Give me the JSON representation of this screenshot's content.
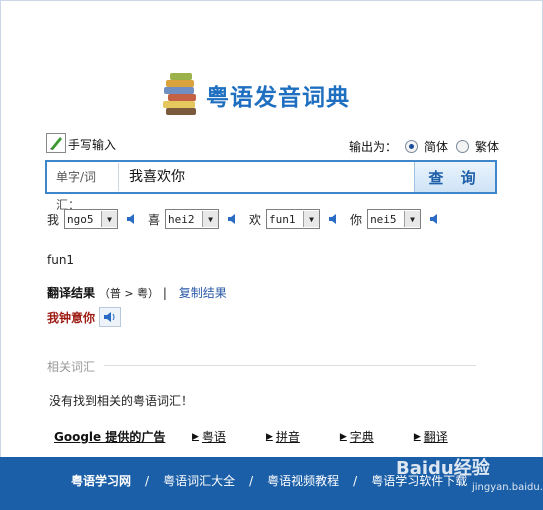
{
  "app": {
    "title": "粤语发音词典"
  },
  "handwrite": {
    "label": "手写输入"
  },
  "output": {
    "label": "输出为：",
    "options": [
      {
        "label": "简体",
        "selected": true
      },
      {
        "label": "繁体",
        "selected": false
      }
    ]
  },
  "search": {
    "field_label": "单字/词汇：",
    "value": "我喜欢你",
    "button": "查 询"
  },
  "syllables": [
    {
      "char": "我",
      "value": "ngo5"
    },
    {
      "char": "喜",
      "value": "hei2"
    },
    {
      "char": "欢",
      "value": "fun1"
    },
    {
      "char": "你",
      "value": "nei5"
    }
  ],
  "phonetic_line": "fun1",
  "translation": {
    "label": "翻译结果",
    "direction": "（普 > 粤）",
    "separator": "|",
    "copy_link": "复制结果",
    "result": "我钟意你"
  },
  "related": {
    "title": "相关词汇",
    "empty_message": "没有找到相关的粤语词汇！"
  },
  "ads": {
    "google_label": "Google 提供的广告",
    "links": [
      "粤语",
      "拼音",
      "字典",
      "翻译"
    ]
  },
  "footer": {
    "links": [
      "粤语学习网",
      "粤语词汇大全",
      "粤语视频教程",
      "粤语学习软件下载"
    ],
    "separator": "/"
  },
  "watermark": {
    "brand": "Baidu经验",
    "url": "jingyan.baidu.com"
  },
  "colors": {
    "accent": "#1f6fc1",
    "footer_bg": "#1b5fa8",
    "result_red": "#9c1a12"
  }
}
